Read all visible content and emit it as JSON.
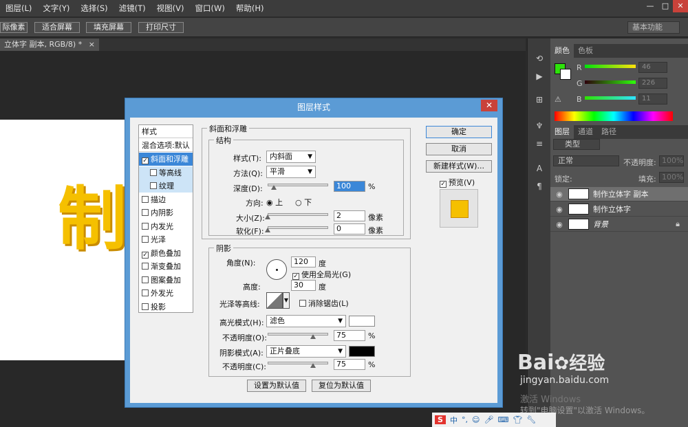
{
  "menubar": {
    "items": [
      "图层(L)",
      "文字(Y)",
      "选择(S)",
      "滤镜(T)",
      "视图(V)",
      "窗口(W)",
      "帮助(H)"
    ],
    "window_controls": [
      "—",
      "□",
      "✕"
    ]
  },
  "options_bar": {
    "buttons": [
      "际像素",
      "适合屏幕",
      "填充屏幕",
      "打印尺寸"
    ],
    "workspace": "基本功能"
  },
  "document": {
    "tab_title": "立体字 副本, RGB/8) *",
    "tab_close": "×",
    "canvas_text": "制"
  },
  "color_panel": {
    "tabs": [
      "颜色",
      "色板"
    ],
    "channels": [
      {
        "name": "R",
        "value": "46"
      },
      {
        "name": "G",
        "value": "226"
      },
      {
        "name": "B",
        "value": "11"
      }
    ],
    "fg_color": "#2ee20b"
  },
  "layers_panel": {
    "tabs": [
      "图层",
      "通道",
      "路径"
    ],
    "filter_label": "类型",
    "blend_mode": "正常",
    "opacity_label": "不透明度:",
    "opacity_value": "100%",
    "lock_label": "锁定:",
    "fill_label": "填充:",
    "fill_value": "100%",
    "layers": [
      {
        "name": "制作立体字 副本",
        "selected": true
      },
      {
        "name": "制作立体字",
        "selected": false
      },
      {
        "name": "背景",
        "selected": false,
        "locked": true
      }
    ]
  },
  "dialog": {
    "title": "图层样式",
    "close": "✕",
    "styles_header": "样式",
    "blend_options": "混合选项:默认",
    "style_items": [
      {
        "label": "斜面和浮雕",
        "checked": true,
        "selected": true,
        "sub": false
      },
      {
        "label": "等高线",
        "checked": false,
        "selected": false,
        "sub": true
      },
      {
        "label": "纹理",
        "checked": false,
        "selected": false,
        "sub": true
      },
      {
        "label": "描边",
        "checked": false,
        "selected": false,
        "sub": false
      },
      {
        "label": "内阴影",
        "checked": false,
        "selected": false,
        "sub": false
      },
      {
        "label": "内发光",
        "checked": false,
        "selected": false,
        "sub": false
      },
      {
        "label": "光泽",
        "checked": false,
        "selected": false,
        "sub": false
      },
      {
        "label": "颜色叠加",
        "checked": true,
        "selected": false,
        "sub": false
      },
      {
        "label": "渐变叠加",
        "checked": false,
        "selected": false,
        "sub": false
      },
      {
        "label": "图案叠加",
        "checked": false,
        "selected": false,
        "sub": false
      },
      {
        "label": "外发光",
        "checked": false,
        "selected": false,
        "sub": false
      },
      {
        "label": "投影",
        "checked": false,
        "selected": false,
        "sub": false
      }
    ],
    "bevel": {
      "group_title": "斜面和浮雕",
      "structure_title": "结构",
      "style_label": "样式(T):",
      "style_value": "内斜面",
      "method_label": "方法(Q):",
      "method_value": "平滑",
      "depth_label": "深度(D):",
      "depth_value": "100",
      "depth_unit": "%",
      "depth_level": 0.1,
      "direction_label": "方向:",
      "direction_up": "上",
      "direction_down": "下",
      "size_label": "大小(Z):",
      "size_value": "2",
      "size_unit": "像素",
      "size_level": 0.0,
      "soften_label": "软化(F):",
      "soften_value": "0",
      "soften_unit": "像素",
      "soften_level": 0.0
    },
    "shading": {
      "title": "阴影",
      "angle_label": "角度(N):",
      "angle_value": "120",
      "angle_unit": "度",
      "global_light": "使用全局光(G)",
      "altitude_label": "高度:",
      "altitude_value": "30",
      "altitude_unit": "度",
      "gloss_label": "光泽等高线:",
      "antialias": "消除锯齿(L)",
      "highlight_label": "高光模式(H):",
      "highlight_value": "滤色",
      "highlight_color": "#ffffff",
      "hl_opacity_label": "不透明度(O):",
      "hl_opacity_value": "75",
      "hl_opacity_level": 0.75,
      "shadow_label": "阴影模式(A):",
      "shadow_value": "正片叠底",
      "shadow_color": "#000000",
      "sh_opacity_label": "不透明度(C):",
      "sh_opacity_value": "75",
      "sh_opacity_level": 0.75,
      "pct": "%"
    },
    "make_default": "设置为默认值",
    "reset_default": "复位为默认值",
    "ok": "确定",
    "cancel": "取消",
    "new_style": "新建样式(W)...",
    "preview": "预览(V)",
    "preview_color": "#f5c000"
  },
  "watermark": {
    "brand": "Bai",
    "brand2": "经验",
    "url": "jingyan.baidu.com",
    "activate1": "激活 Windows",
    "activate2": "转到\"电脑设置\"以激活 Windows。"
  },
  "taskbar": {
    "ime": "中"
  }
}
